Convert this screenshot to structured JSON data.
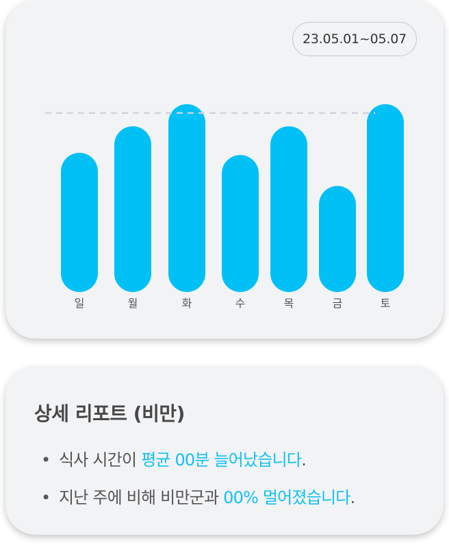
{
  "date_range": "23.05.01~05.07",
  "chart_data": {
    "type": "bar",
    "categories": [
      "일",
      "월",
      "화",
      "수",
      "목",
      "금",
      "토"
    ],
    "values": [
      63,
      75,
      85,
      62,
      75,
      48,
      85
    ],
    "average_line": 81,
    "ylim": [
      0,
      85
    ],
    "bar_color": "#00c0f5",
    "average_line_color": "#cfd3d8",
    "grid": false
  },
  "report": {
    "title": "상세 리포트 (비만)",
    "items": [
      {
        "bullet": "•",
        "prefix": "식사 시간이 ",
        "highlight": "평균 00분 늘어났습니다",
        "suffix": "."
      },
      {
        "bullet": "•",
        "prefix": "지난 주에 비해 비만군과 ",
        "highlight": "00% 멀어졌습니다",
        "suffix": "."
      }
    ],
    "highlight_color": "#12c0f0"
  }
}
